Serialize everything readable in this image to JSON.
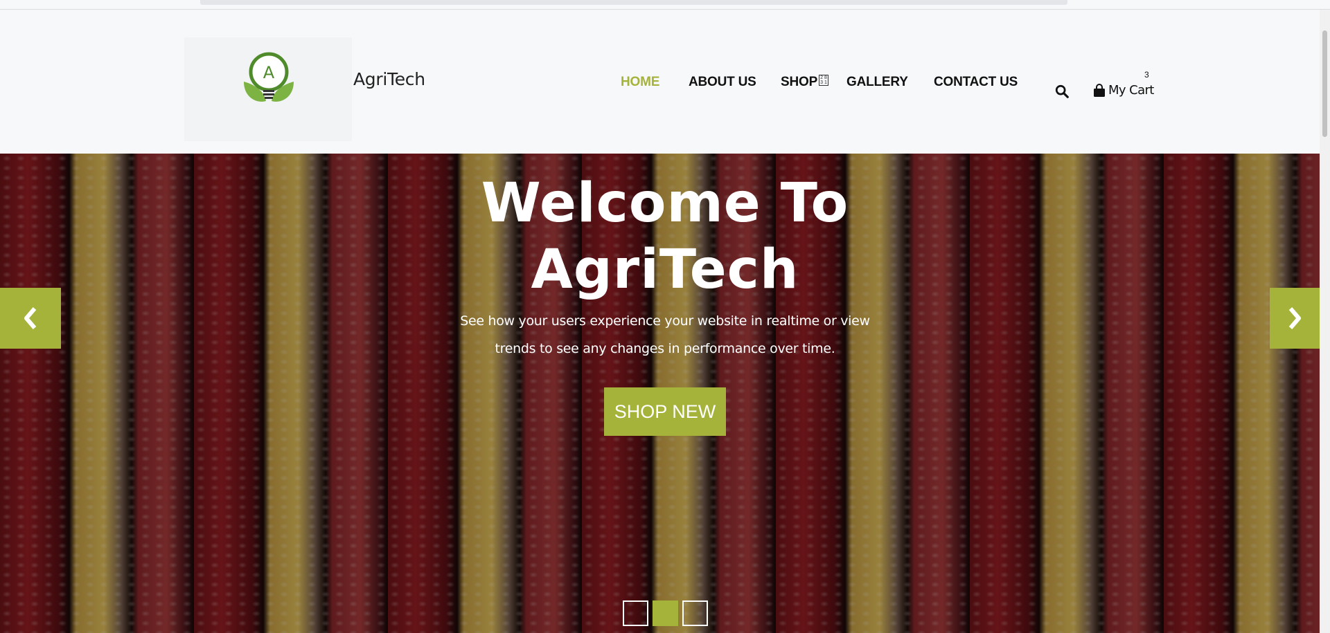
{
  "brand": {
    "name": "AgriTech",
    "logo_letter": "A"
  },
  "nav": {
    "items": [
      {
        "label": "HOME",
        "active": true
      },
      {
        "label": "ABOUT US",
        "active": false
      },
      {
        "label": "SHOP",
        "active": false
      },
      {
        "label": "GALLERY",
        "active": false
      },
      {
        "label": "CONTACT US",
        "active": false
      }
    ],
    "shop_icon_text": "2 8 3 1"
  },
  "header_actions": {
    "search_icon": "search-icon",
    "cart_label": "My Cart",
    "cart_count": "3"
  },
  "hero": {
    "title_line1": "Welcome To",
    "title_line2": "AgriTech",
    "subtitle": "See how your users experience your website in realtime or view trends to see any changes in performance over time.",
    "cta_label": "SHOP NEW",
    "slides_total": 3,
    "active_slide": 2
  },
  "colors": {
    "accent": "#a6b33b",
    "nav_text": "#111111",
    "header_bg": "#f7f8f9"
  }
}
